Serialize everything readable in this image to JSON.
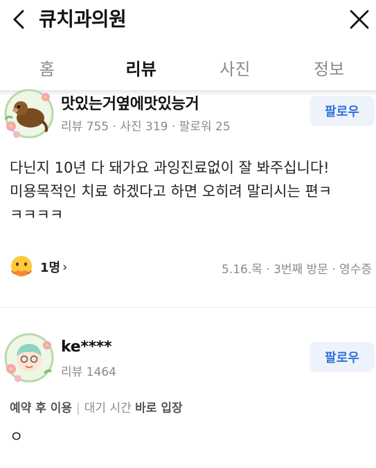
{
  "header": {
    "title": "큐치과의원",
    "back_icon": "chevron-left-icon",
    "close_icon": "close-icon"
  },
  "tabs": [
    {
      "label": "홈",
      "active": false
    },
    {
      "label": "리뷰",
      "active": true
    },
    {
      "label": "사진",
      "active": false
    },
    {
      "label": "정보",
      "active": false
    }
  ],
  "reviews": [
    {
      "username": "맛있는거옆에맛있능거",
      "stats": "리뷰 755 · 사진 319 · 팔로워 25",
      "follow_label": "팔로우",
      "text": "다닌지 10년 다 돼가요 과잉진료없이 잘 봐주십니다!\n미용목적인 치료 하겠다고 하면 오히려 말리시는 편ㅋ\nㅋㅋㅋㅋ",
      "reaction_count": "1명",
      "reaction_chevron": "›",
      "visit_meta": "5.16.목 · 3번째 방문 · 영수증",
      "avatar_icon": "sea-otter-avatar-icon",
      "reaction_icon": "emoji-face-icon"
    },
    {
      "username": "ke****",
      "stats": "리뷰 1464",
      "follow_label": "팔로우",
      "visit_info": {
        "reservation": "예약 후 이용",
        "wait_label": "대기 시간",
        "wait_value": "바로 입장",
        "separator": "|"
      },
      "text": "ㅇ",
      "avatar_icon": "person-avatar-icon"
    }
  ],
  "colors": {
    "accent": "#2f73d8",
    "follow_bg": "#eef3fb",
    "muted": "#8a8a8a",
    "divider": "#eeeeee"
  }
}
